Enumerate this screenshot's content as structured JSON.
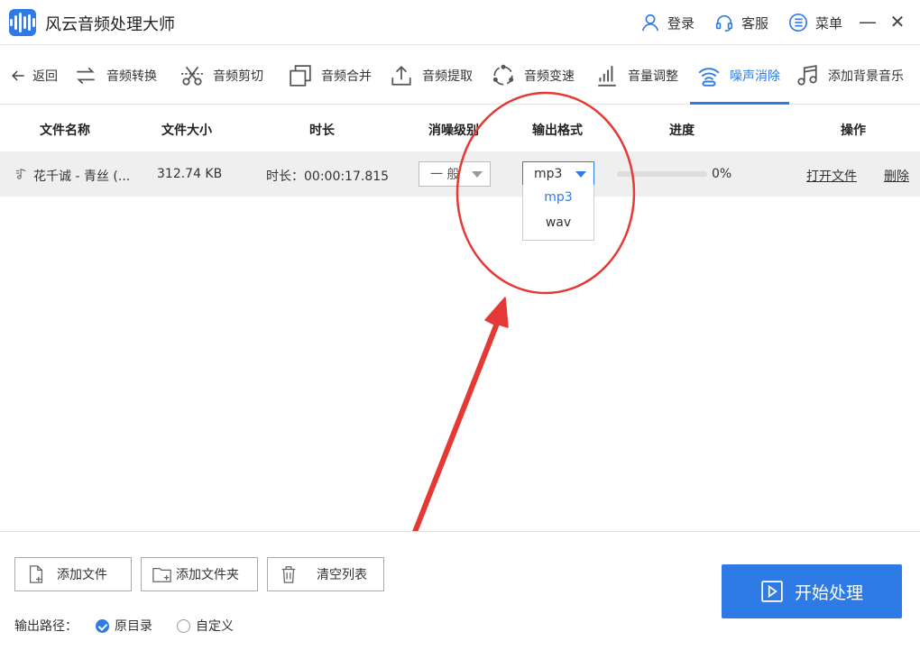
{
  "app": {
    "title": "风云音频处理大师"
  },
  "titlebar": {
    "login": "登录",
    "service": "客服",
    "menu": "菜单"
  },
  "toolbar": {
    "back": "返回",
    "items": [
      "音频转换",
      "音频剪切",
      "音频合并",
      "音频提取",
      "音频变速",
      "音量调整",
      "噪声消除",
      "添加背景音乐"
    ],
    "active": "噪声消除"
  },
  "table": {
    "headers": {
      "name": "文件名称",
      "size": "文件大小",
      "duration": "时长",
      "level": "消噪级别",
      "format": "输出格式",
      "progress": "进度",
      "action": "操作"
    },
    "rows": [
      {
        "name": "花千诚 - 青丝 (...",
        "size": "312.74 KB",
        "duration": "时长：00:00:17.815",
        "level": "一 般",
        "format": "mp3",
        "progress_pct": 0,
        "progress_text": "0%",
        "open": "打开文件",
        "delete": "删除"
      }
    ]
  },
  "format_dropdown": {
    "options": [
      "mp3",
      "wav"
    ],
    "selected": "mp3"
  },
  "bottom": {
    "add_file": "添加文件",
    "add_folder": "添加文件夹",
    "clear_list": "清空列表",
    "output_path_label": "输出路径：",
    "radio_original": "原目录",
    "radio_custom": "自定义",
    "start": "开始处理"
  },
  "colors": {
    "accent": "#2f7be5",
    "annotation": "#e53935"
  }
}
